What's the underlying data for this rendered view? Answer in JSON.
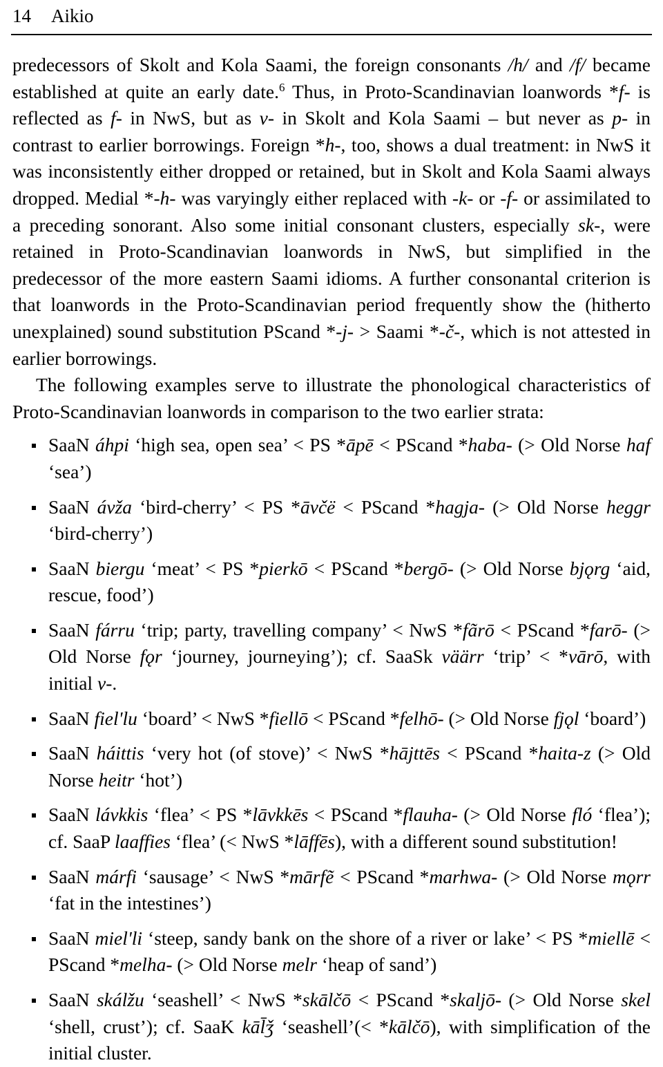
{
  "running_head": {
    "page_number": "14",
    "author": "Aikio"
  },
  "body": {
    "paragraph_1_parts": {
      "t1": "predecessors of Skolt and Kola Saami, the foreign consonants ",
      "i1": "/h/",
      "t2": " and ",
      "i2": "/f/",
      "t3": " became established at quite an early date.",
      "footnote_marker": "6",
      "t4": " Thus, in Proto-Scandinavian loanwords *",
      "i3": "f",
      "t5": "- is reflected as ",
      "i4": "f",
      "t6": "- in NwS, but as ",
      "i5": "v",
      "t7": "- in Skolt and Kola Saami – but never as ",
      "i6": "p",
      "t8": "- in contrast to earlier borrowings. Foreign *",
      "i7": "h",
      "t9": "-, too, shows a dual treatment: in NwS it was inconsistently either dropped or retained, but in Skolt and Kola Saami always dropped. Medial *-",
      "i8": "h",
      "t10": "- was varyingly either replaced with -",
      "i9": "k",
      "t11": "- or -",
      "i10": "f",
      "t12": "- or assimilated to a preceding sonorant. Also some initial consonant clusters, especially ",
      "i11": "sk",
      "t13": "-, were retained in Proto-Scandinavian loanwords in NwS, but simplified in the predecessor of the more eastern Saami idioms. A further consonantal criterion is that loanwords in the Proto-Scandinavian period frequently show the (hitherto unexplained) sound substitution PScand *-",
      "i12": "j",
      "t14": "- > Saami *-",
      "i13": "č",
      "t15": "-, which is not attested in earlier borrowings."
    },
    "paragraph_2": "The following examples serve to illustrate the phonological characteristics of Proto-Scandinavian loanwords in comparison to the two earlier strata:"
  },
  "examples": [
    {
      "id": "example-ahpi",
      "parts": [
        {
          "style": "roman",
          "text": "SaaN "
        },
        {
          "style": "italic",
          "text": "áhpi"
        },
        {
          "style": "roman",
          "text": " ‘high sea, open sea’ < PS *"
        },
        {
          "style": "italic",
          "text": "āpē"
        },
        {
          "style": "roman",
          "text": " < PScand *"
        },
        {
          "style": "italic",
          "text": "haba"
        },
        {
          "style": "roman",
          "text": "- (> Old Norse "
        },
        {
          "style": "italic",
          "text": "haf"
        },
        {
          "style": "roman",
          "text": " ‘sea’)"
        }
      ]
    },
    {
      "id": "example-avza",
      "parts": [
        {
          "style": "roman",
          "text": "SaaN "
        },
        {
          "style": "italic",
          "text": "ávža"
        },
        {
          "style": "roman",
          "text": " ‘bird-cherry’ < PS *"
        },
        {
          "style": "italic",
          "text": "āvčë"
        },
        {
          "style": "roman",
          "text": " < PScand *"
        },
        {
          "style": "italic",
          "text": "hagja"
        },
        {
          "style": "roman",
          "text": "- (> Old Norse "
        },
        {
          "style": "italic",
          "text": "heggr"
        },
        {
          "style": "roman",
          "text": " ‘bird-cherry’)"
        }
      ]
    },
    {
      "id": "example-biergu",
      "parts": [
        {
          "style": "roman",
          "text": "SaaN "
        },
        {
          "style": "italic",
          "text": "biergu"
        },
        {
          "style": "roman",
          "text": " ‘meat’ < PS *"
        },
        {
          "style": "italic",
          "text": "pierkō"
        },
        {
          "style": "roman",
          "text": " < PScand *"
        },
        {
          "style": "italic",
          "text": "bergō"
        },
        {
          "style": "roman",
          "text": "- (> Old Norse "
        },
        {
          "style": "italic",
          "text": "bjǫrg"
        },
        {
          "style": "roman",
          "text": " ‘aid, rescue, food’)"
        }
      ]
    },
    {
      "id": "example-farru",
      "parts": [
        {
          "style": "roman",
          "text": "SaaN "
        },
        {
          "style": "italic",
          "text": "fárru"
        },
        {
          "style": "roman",
          "text": " ‘trip; party, travelling company’ < NwS *"
        },
        {
          "style": "italic",
          "text": "fãrō"
        },
        {
          "style": "roman",
          "text": " < PScand *"
        },
        {
          "style": "italic",
          "text": "farō"
        },
        {
          "style": "roman",
          "text": "- (> Old Norse "
        },
        {
          "style": "italic",
          "text": "fǫr"
        },
        {
          "style": "roman",
          "text": " ‘journey, journeying’); cf. SaaSk "
        },
        {
          "style": "italic",
          "text": "väärr"
        },
        {
          "style": "roman",
          "text": " ‘trip’ < *"
        },
        {
          "style": "italic",
          "text": "vārō"
        },
        {
          "style": "roman",
          "text": ", with initial "
        },
        {
          "style": "italic",
          "text": "v"
        },
        {
          "style": "roman",
          "text": "-."
        }
      ]
    },
    {
      "id": "example-fiellu",
      "parts": [
        {
          "style": "roman",
          "text": "SaaN "
        },
        {
          "style": "italic",
          "text": "fiel'lu"
        },
        {
          "style": "roman",
          "text": " ‘board’ < NwS *"
        },
        {
          "style": "italic",
          "text": "fiellō"
        },
        {
          "style": "roman",
          "text": " < PScand *"
        },
        {
          "style": "italic",
          "text": "felhō"
        },
        {
          "style": "roman",
          "text": "- (> Old Norse "
        },
        {
          "style": "italic",
          "text": "fjǫl"
        },
        {
          "style": "roman",
          "text": " ‘board’)"
        }
      ]
    },
    {
      "id": "example-haittis",
      "parts": [
        {
          "style": "roman",
          "text": "SaaN "
        },
        {
          "style": "italic",
          "text": "háittis"
        },
        {
          "style": "roman",
          "text": " ‘very hot (of stove)’ < NwS *"
        },
        {
          "style": "italic",
          "text": "hājttēs"
        },
        {
          "style": "roman",
          "text": " < PScand *"
        },
        {
          "style": "italic",
          "text": "haita-z"
        },
        {
          "style": "roman",
          "text": " (> Old Norse "
        },
        {
          "style": "italic",
          "text": "heitr"
        },
        {
          "style": "roman",
          "text": " ‘hot’)"
        }
      ]
    },
    {
      "id": "example-lavkkis",
      "parts": [
        {
          "style": "roman",
          "text": "SaaN "
        },
        {
          "style": "italic",
          "text": "lávkkis"
        },
        {
          "style": "roman",
          "text": " ‘flea’ < PS *"
        },
        {
          "style": "italic",
          "text": "lāvkkēs"
        },
        {
          "style": "roman",
          "text": " < PScand *"
        },
        {
          "style": "italic",
          "text": "flauha"
        },
        {
          "style": "roman",
          "text": "- (> Old Norse "
        },
        {
          "style": "italic",
          "text": "fló"
        },
        {
          "style": "roman",
          "text": " ‘flea’); cf. SaaP "
        },
        {
          "style": "italic",
          "text": "laaffies"
        },
        {
          "style": "roman",
          "text": " ‘flea’ (< NwS *"
        },
        {
          "style": "italic",
          "text": "lāffēs"
        },
        {
          "style": "roman",
          "text": "), with a different sound substitution!"
        }
      ]
    },
    {
      "id": "example-marfi",
      "parts": [
        {
          "style": "roman",
          "text": "SaaN "
        },
        {
          "style": "italic",
          "text": "márfi"
        },
        {
          "style": "roman",
          "text": " ‘sausage’ < NwS *"
        },
        {
          "style": "italic",
          "text": "mārfẽ"
        },
        {
          "style": "roman",
          "text": " < PScand *"
        },
        {
          "style": "italic",
          "text": "marhwa"
        },
        {
          "style": "roman",
          "text": "- (> Old Norse "
        },
        {
          "style": "italic",
          "text": "mǫrr"
        },
        {
          "style": "roman",
          "text": " ‘fat in the intestines’)"
        }
      ]
    },
    {
      "id": "example-mielli",
      "parts": [
        {
          "style": "roman",
          "text": "SaaN "
        },
        {
          "style": "italic",
          "text": "miel'li"
        },
        {
          "style": "roman",
          "text": " ‘steep, sandy bank on the shore of a river or lake’ < PS *"
        },
        {
          "style": "italic",
          "text": "miellē"
        },
        {
          "style": "roman",
          "text": " < PScand *"
        },
        {
          "style": "italic",
          "text": "melha"
        },
        {
          "style": "roman",
          "text": "- (> Old Norse "
        },
        {
          "style": "italic",
          "text": "melr"
        },
        {
          "style": "roman",
          "text": " ‘heap of sand’)"
        }
      ]
    },
    {
      "id": "example-skalzu",
      "parts": [
        {
          "style": "roman",
          "text": "SaaN "
        },
        {
          "style": "italic",
          "text": "skálžu"
        },
        {
          "style": "roman",
          "text": " ‘seashell’ < NwS *"
        },
        {
          "style": "italic",
          "text": "skālčō"
        },
        {
          "style": "roman",
          "text": " < PScand *"
        },
        {
          "style": "italic",
          "text": "skaljō"
        },
        {
          "style": "roman",
          "text": "- (> Old Norse "
        },
        {
          "style": "italic",
          "text": "skel"
        },
        {
          "style": "roman",
          "text": " ‘shell, crust’); cf. SaaK "
        },
        {
          "style": "italic",
          "text": "kāl̄ǯ"
        },
        {
          "style": "roman",
          "text": " ‘seashell’(< *"
        },
        {
          "style": "italic",
          "text": "kālčō"
        },
        {
          "style": "roman",
          "text": "), with simplification of the initial cluster."
        }
      ]
    }
  ]
}
